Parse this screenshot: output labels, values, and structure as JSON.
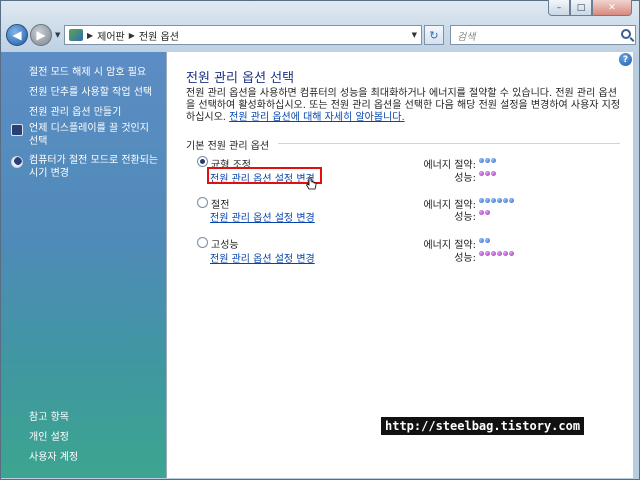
{
  "window": {
    "minimize": "–",
    "maximize": "□",
    "close": "✕"
  },
  "nav": {
    "back_glyph": "◀",
    "forward_glyph": "▶",
    "breadcrumb": [
      "제어판",
      "전원 옵션"
    ],
    "refresh_glyph": "↻",
    "search_placeholder": "검색"
  },
  "sidebar": {
    "tasks": [
      {
        "label": "절전 모드 해제 시 암호 필요",
        "icon": null
      },
      {
        "label": "전원 단추를 사용할 작업 선택",
        "icon": null
      },
      {
        "label": "전원 관리 옵션 만들기",
        "icon": null
      },
      {
        "label": "언제 디스플레이를 끌 것인지 선택",
        "icon": "monitor-icon"
      },
      {
        "label": "컴퓨터가 절전 모드로 전환되는 시기 변경",
        "icon": "moon-icon"
      }
    ],
    "see_also_heading": "참고 항목",
    "see_also": [
      "개인 설정",
      "사용자 계정"
    ]
  },
  "main": {
    "help_glyph": "?",
    "title": "전원 관리 옵션 선택",
    "description": "전원 관리 옵션을 사용하면 컴퓨터의 성능을 최대화하거나 에너지를 절약할 수 있습니다. 전원 관리 옵션을 선택하여 활성화하십시오. 또는 전원 관리 옵션을 선택한 다음 해당 전원 설정을 변경하여 사용자 지정하십시오.",
    "learn_more_link": "전원 관리 옵션에 대해 자세히 알아봅니다.",
    "section_label": "기본 전원 관리 옵션",
    "energy_label": "에너지 절약:",
    "performance_label": "성능:",
    "change_link": "전원 관리 옵션 설정 변경",
    "plans": [
      {
        "name": "균형 조정",
        "selected": true,
        "energy_dots": 3,
        "performance_dots": 3
      },
      {
        "name": "절전",
        "selected": false,
        "energy_dots": 6,
        "performance_dots": 2
      },
      {
        "name": "고성능",
        "selected": false,
        "energy_dots": 2,
        "performance_dots": 6
      }
    ]
  },
  "watermark": "http://steelbag.tistory.com",
  "colors": {
    "energy_dot": "#2b5fc7",
    "performance_dot": "#9a2bb3",
    "highlight": "#e01010"
  }
}
